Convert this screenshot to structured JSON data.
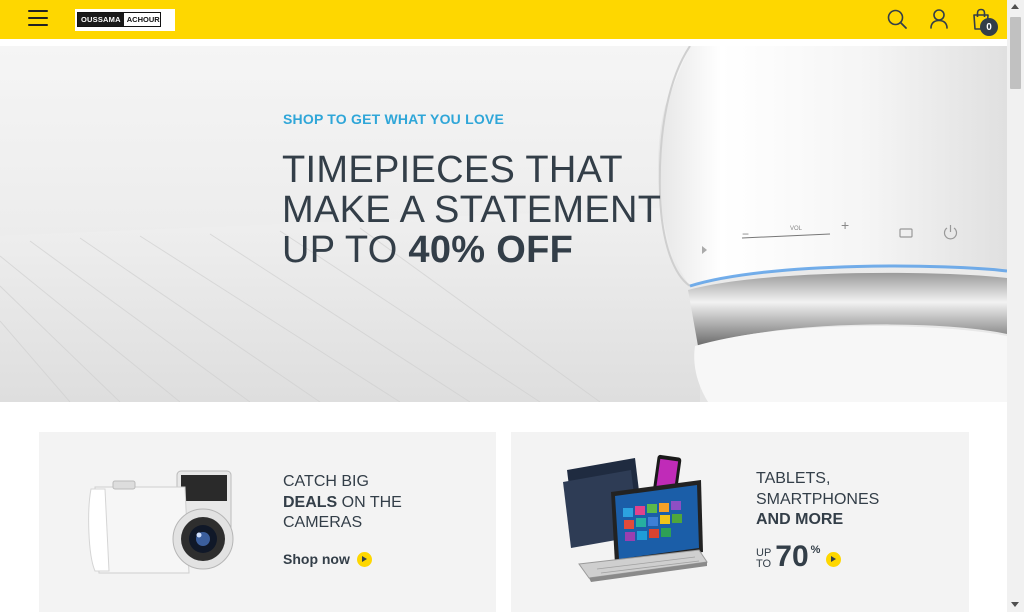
{
  "header": {
    "logo": {
      "left": "OUSSAMA",
      "right": "ACHOUR"
    },
    "cart_count": "0",
    "icons": [
      "menu-icon",
      "search-icon",
      "user-icon",
      "shopping-bag-icon"
    ],
    "accent_color": "#fed700"
  },
  "hero": {
    "eyebrow": "SHOP TO GET WHAT YOU LOVE",
    "title_line1": "TIMEPIECES THAT",
    "title_line2": "MAKE A STATEMENT",
    "title_line3_prefix": "UP TO ",
    "title_line3_bold": "40% OFF",
    "eyebrow_color": "#2fa6d8",
    "speaker_labels": {
      "vol": "VOL",
      "minus": "−",
      "plus": "+"
    }
  },
  "promos": [
    {
      "line1": "CATCH BIG",
      "line2_bold": "DEALS",
      "line2_rest": " ON THE",
      "line3": "CAMERAS",
      "cta": "Shop now"
    },
    {
      "line1": "TABLETS,",
      "line2": "SMARTPHONES",
      "line3_bold": "AND MORE",
      "upto_line1": "UP",
      "upto_line2": "TO",
      "upto_value": "70",
      "upto_unit": "%"
    }
  ]
}
